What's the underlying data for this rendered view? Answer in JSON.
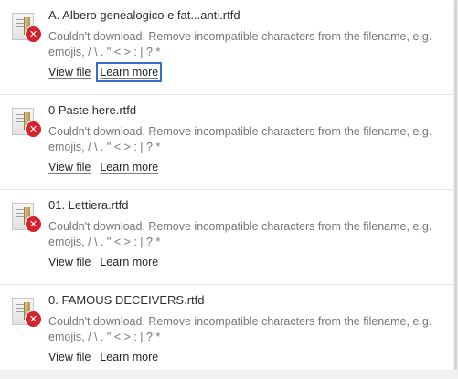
{
  "downloads": [
    {
      "filename": "A. Albero genealogico e fat...anti.rtfd",
      "message": "Couldn't download. Remove incompatible characters from the filename, e.g. emojis, / \\ . \" < > : | ? *",
      "view_label": "View file",
      "learn_label": "Learn more"
    },
    {
      "filename": "0 Paste here.rtfd",
      "message": "Couldn't download. Remove incompatible characters from the filename, e.g. emojis, / \\ . \" < > : | ? *",
      "view_label": "View file",
      "learn_label": "Learn more"
    },
    {
      "filename": "01. Lettiera.rtfd",
      "message": "Couldn't download. Remove incompatible characters from the filename, e.g. emojis, / \\ . \" < > : | ? *",
      "view_label": "View file",
      "learn_label": "Learn more"
    },
    {
      "filename": "0. FAMOUS DECEIVERS.rtfd",
      "message": "Couldn't download. Remove incompatible characters from the filename, e.g. emojis, / \\ . \" < > : | ? *",
      "view_label": "View file",
      "learn_label": "Learn more"
    }
  ],
  "error_glyph": "✕",
  "colors": {
    "error_badge": "#d6222f",
    "focus_ring": "#2f6fd6",
    "message_text": "#777777",
    "link_text": "#272727"
  },
  "icons": {
    "file": "rtfd-document-icon",
    "error": "download-error-icon"
  }
}
